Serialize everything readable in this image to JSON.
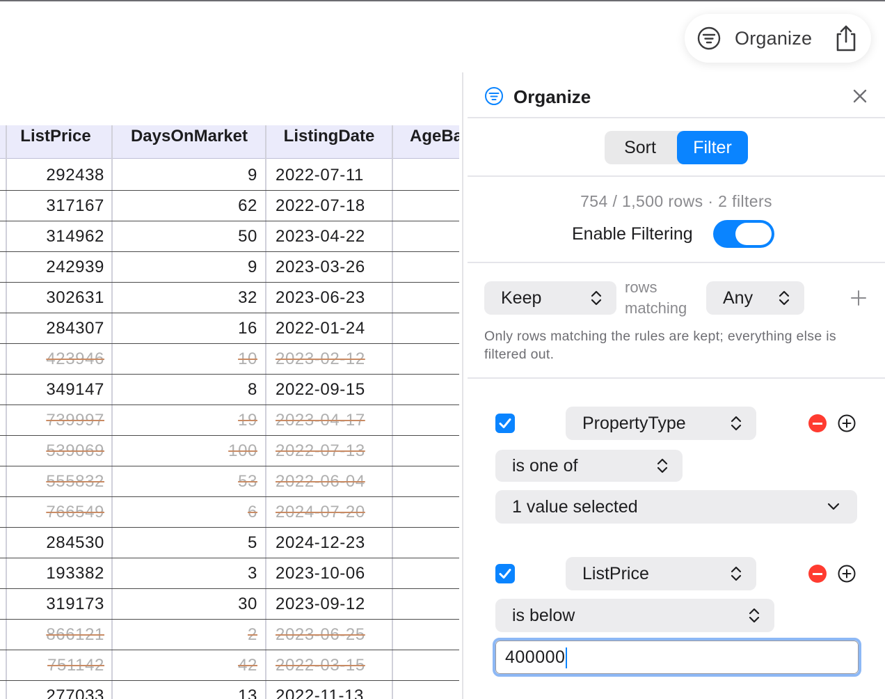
{
  "toolbar": {
    "organize_label": "Organize",
    "share_icon": "share-icon",
    "filter_icon": "filter-icon"
  },
  "table": {
    "columns": [
      "ListPrice",
      "DaysOnMarket",
      "ListingDate",
      "AgeBa"
    ],
    "rows": [
      {
        "price": "292438",
        "days": "9",
        "date": "2022-07-11",
        "filtered": false
      },
      {
        "price": "317167",
        "days": "62",
        "date": "2022-07-18",
        "filtered": false
      },
      {
        "price": "314962",
        "days": "50",
        "date": "2023-04-22",
        "filtered": false
      },
      {
        "price": "242939",
        "days": "9",
        "date": "2023-03-26",
        "filtered": false
      },
      {
        "price": "302631",
        "days": "32",
        "date": "2023-06-23",
        "filtered": false
      },
      {
        "price": "284307",
        "days": "16",
        "date": "2022-01-24",
        "filtered": false
      },
      {
        "price": "423946",
        "days": "10",
        "date": "2023-02-12",
        "filtered": true
      },
      {
        "price": "349147",
        "days": "8",
        "date": "2022-09-15",
        "filtered": false
      },
      {
        "price": "739997",
        "days": "19",
        "date": "2023-04-17",
        "filtered": true
      },
      {
        "price": "539069",
        "days": "100",
        "date": "2022-07-13",
        "filtered": true
      },
      {
        "price": "555832",
        "days": "53",
        "date": "2022-06-04",
        "filtered": true
      },
      {
        "price": "766549",
        "days": "6",
        "date": "2024-07-20",
        "filtered": true
      },
      {
        "price": "284530",
        "days": "5",
        "date": "2024-12-23",
        "filtered": false
      },
      {
        "price": "193382",
        "days": "3",
        "date": "2023-10-06",
        "filtered": false
      },
      {
        "price": "319173",
        "days": "30",
        "date": "2023-09-12",
        "filtered": false
      },
      {
        "price": "866121",
        "days": "2",
        "date": "2023-06-25",
        "filtered": true
      },
      {
        "price": "751142",
        "days": "42",
        "date": "2022-03-15",
        "filtered": true
      },
      {
        "price": "277033",
        "days": "13",
        "date": "2022-11-13",
        "filtered": false
      }
    ]
  },
  "panel": {
    "title": "Organize",
    "tabs": {
      "sort": "Sort",
      "filter": "Filter",
      "active": "Filter"
    },
    "row_count": "754 / 1,500 rows · 2 filters",
    "enable_filtering_label": "Enable Filtering",
    "enable_filtering_on": true,
    "mode_select": "Keep",
    "rows_matching_label": "rows matching",
    "match_select": "Any",
    "description": "Only rows matching the rules are kept; everything else is filtered out.",
    "rules": [
      {
        "enabled": true,
        "field": "PropertyType",
        "operator": "is one of",
        "value": "1 value selected"
      },
      {
        "enabled": true,
        "field": "ListPrice",
        "operator": "is below",
        "value": "400000"
      }
    ]
  },
  "colors": {
    "accent": "#0a84ff",
    "remove": "#ff3b30",
    "header_bg": "#ebebfb",
    "strike": "#c98b64"
  }
}
